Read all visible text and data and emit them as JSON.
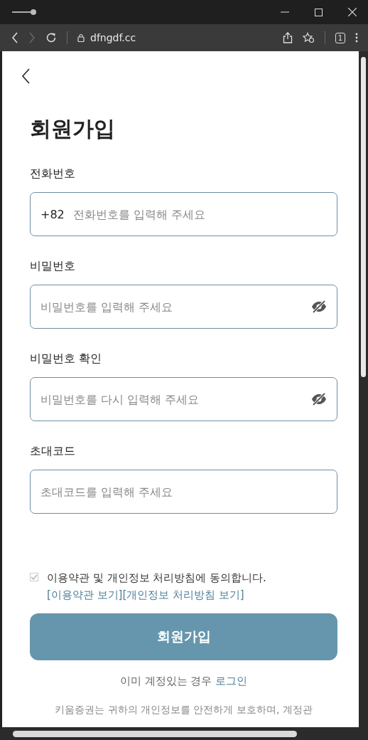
{
  "browser": {
    "url": "dfngdf.cc",
    "tab_count": "1",
    "forward_disabled": true
  },
  "page": {
    "title": "회원가입",
    "fields": [
      {
        "kind": "phone",
        "label": "전화번호",
        "prefix": "+82",
        "placeholder": "전화번호를 입력해 주세요"
      },
      {
        "kind": "password",
        "label": "비밀번호",
        "placeholder": "비밀번호를 입력해 주세요"
      },
      {
        "kind": "password",
        "label": "비밀번호 확인",
        "placeholder": "비밀번호를 다시 입력해 주세요"
      },
      {
        "kind": "text",
        "label": "초대코드",
        "placeholder": "초대코드를 입력해 주세요"
      }
    ],
    "agreement": {
      "checked": true,
      "text": "이용약관 및 개인정보 처리방침에 동의합니다.",
      "links": [
        "[이용약관 보기]",
        "[개인정보 처리방침 보기]"
      ]
    },
    "submit": "회원가입",
    "login_prompt": {
      "text": "이미 계정있는 경우",
      "link": "로그인"
    },
    "notice": "키움증권는 귀하의 개인정보를 안전하게 보호하며, 계정관"
  }
}
